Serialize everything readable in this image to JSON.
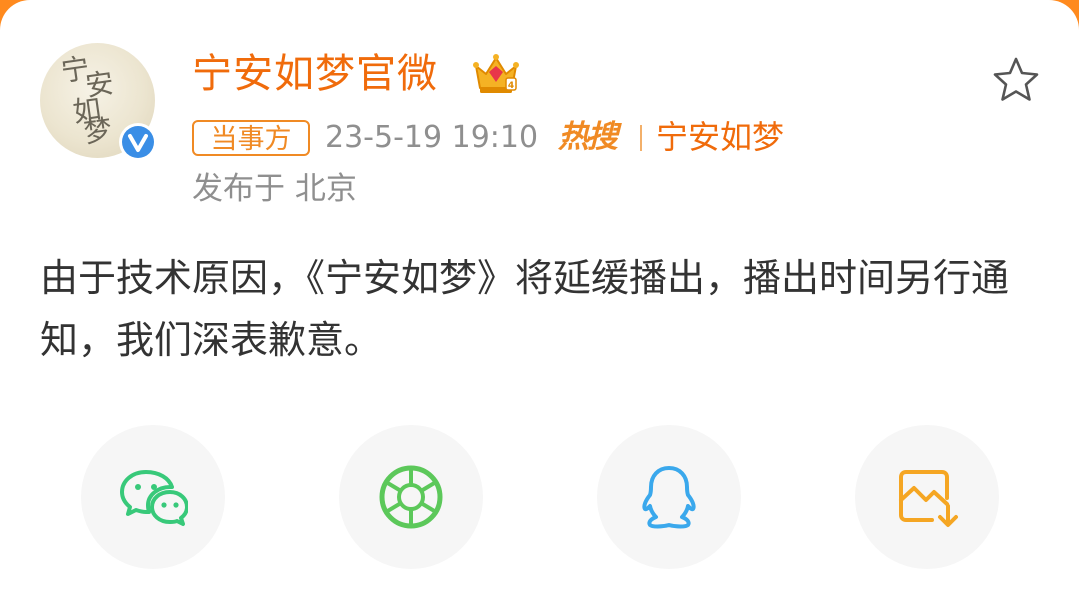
{
  "post": {
    "avatar_text": [
      "宁",
      "安",
      "如",
      "梦"
    ],
    "username": "宁安如梦官微",
    "tag": "当事方",
    "timestamp": "23-5-19 19:10",
    "hot_label": "热搜",
    "topic": "宁安如梦",
    "location": "发布于 北京",
    "content": "由于技术原因，《宁安如梦》将延缓播出，播出时间另行通知，我们深表歉意。"
  },
  "icons": {
    "verified": "verified-badge-icon",
    "crown": "crown-icon",
    "favorite": "star-icon",
    "wechat": "wechat-icon",
    "moments": "moments-icon",
    "qq": "qq-icon",
    "save": "save-image-icon"
  },
  "colors": {
    "accent": "#f06b0b",
    "tag": "#f08a24",
    "meta": "#8f8f8f",
    "text": "#333333",
    "verified": "#3a8ee6",
    "wechat": "#38c97a",
    "moments": "#5cc85a",
    "qq": "#3aa8ec",
    "save": "#f5a623"
  }
}
